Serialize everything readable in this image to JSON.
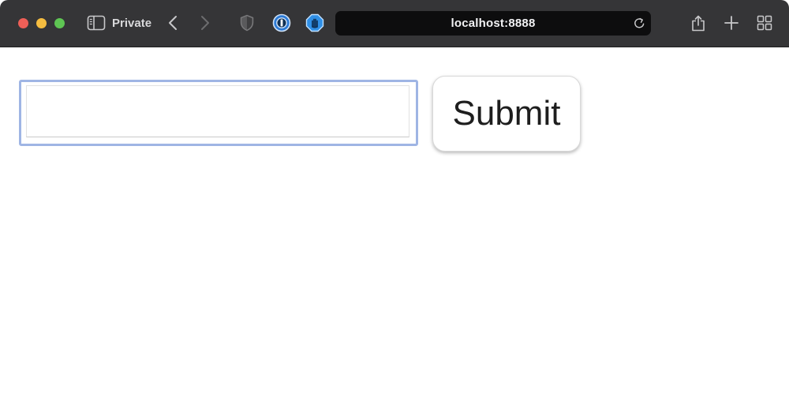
{
  "colors": {
    "toolbar_bg": "#353537",
    "traffic_close": "#ee5f57",
    "traffic_minimize": "#f5bd40",
    "traffic_zoom": "#5ec553",
    "address_bg": "#0d0d0e",
    "input_focus_border": "#9fb5e4",
    "content_bg": "#ffffff"
  },
  "browser": {
    "mode_label": "Private",
    "address": "localhost:8888",
    "toolbar_icons": [
      "sidebar-icon",
      "chevron-left-icon",
      "chevron-right-icon",
      "privacy-shield-icon",
      "password-manager-icon",
      "ad-blocker-icon",
      "reload-icon",
      "share-icon",
      "plus-icon",
      "tab-overview-icon"
    ]
  },
  "form": {
    "input": {
      "value": "",
      "placeholder": ""
    },
    "submit_label": "Submit"
  }
}
